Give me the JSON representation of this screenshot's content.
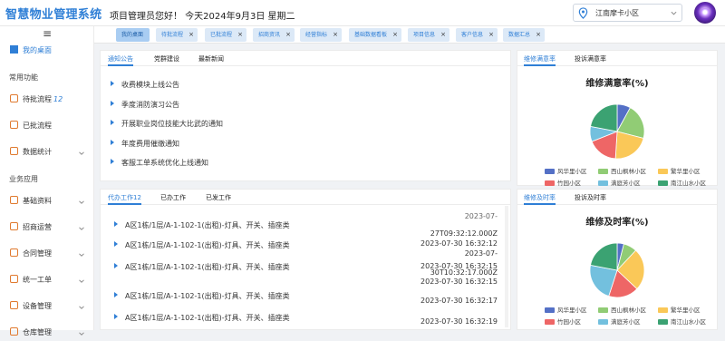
{
  "app": {
    "title": "智慧物业管理系统",
    "greeting": "项目管理员您好！ 今天2024年9月3日 星期二"
  },
  "location": {
    "value": "江南摩卡小区"
  },
  "sidebar": {
    "items": [
      {
        "label": "我的桌面",
        "active": true
      },
      {
        "section": "常用功能"
      },
      {
        "label": "待批流程",
        "badge": "12"
      },
      {
        "label": "已批流程"
      },
      {
        "label": "数据统计",
        "expandable": true
      },
      {
        "section": "业务应用"
      },
      {
        "label": "基础资料",
        "expandable": true
      },
      {
        "label": "招商运营",
        "expandable": true
      },
      {
        "label": "合同管理",
        "expandable": true
      },
      {
        "label": "统一工单",
        "expandable": true
      },
      {
        "label": "设备管理",
        "expandable": true
      },
      {
        "label": "仓库管理",
        "expandable": true
      }
    ]
  },
  "tabs": [
    {
      "label": "我的桌面",
      "active": true
    },
    {
      "label": "待批流程"
    },
    {
      "label": "已批流程"
    },
    {
      "label": "招商资讯"
    },
    {
      "label": "经营指标"
    },
    {
      "label": "基础数据看板"
    },
    {
      "label": "项目信息"
    },
    {
      "label": "客户信息"
    },
    {
      "label": "数据汇总"
    }
  ],
  "notices": {
    "tabs": [
      "通知公告",
      "党群建设",
      "最新新闻"
    ],
    "items": [
      "收费模块上线公告",
      "季度消防演习公告",
      "开展职业岗位技能大比武的通知",
      "年度费用催缴通知",
      "客服工单系统优化上线通知"
    ]
  },
  "work": {
    "tabs": [
      {
        "label": "代办工作",
        "badge": "12"
      },
      {
        "label": "已办工作"
      },
      {
        "label": "已发工作"
      }
    ],
    "top_fragment": "2023-07-",
    "rows": [
      {
        "title": "A区1栋/1层/A-1-102-1(出租)-灯具、开关、插座类",
        "time": [
          "27T09:32:12.000Z",
          "2023-07-30 16:32:12"
        ]
      },
      {
        "title": "A区1栋/1层/A-1-102-1(出租)-灯具、开关、插座类",
        "time": [
          "2023-07-30 16:32:15",
          "2023-07-"
        ]
      },
      {
        "title": "A区1栋/1层/A-1-102-1(出租)-灯具、开关、插座类",
        "time": [
          "30T10:32:17.000Z",
          "2023-07-30 16:32:15"
        ]
      },
      {
        "title": "A区1栋/1层/A-1-102-1(出租)-灯具、开关、插座类",
        "time": [
          "2023-07-30 16:32:17"
        ]
      },
      {
        "title": "A区1栋/1层/A-1-102-1(出租)-灯具、开关、插座类",
        "time": [
          "2023-07-30 16:32:19"
        ]
      }
    ]
  },
  "charts": [
    {
      "tabs": [
        "维修满意率",
        "投诉满意率"
      ],
      "chart_data": {
        "type": "pie",
        "title": "维修满意率(%)",
        "categories": [
          "风华里小区",
          "西山枫林小区",
          "繁华里小区",
          "竹园小区",
          "满庭芳小区",
          "南江山水小区"
        ],
        "values": [
          8,
          21,
          22,
          18,
          9,
          22
        ],
        "colors": [
          "#5470c6",
          "#91cc75",
          "#fac858",
          "#ee6666",
          "#73c0de",
          "#3ba272"
        ],
        "legend": "bottom"
      }
    },
    {
      "tabs": [
        "维修及时率",
        "投诉及时率"
      ],
      "chart_data": {
        "type": "pie",
        "title": "维修及时率(%)",
        "categories": [
          "风华里小区",
          "西山枫林小区",
          "繁华里小区",
          "竹园小区",
          "满庭芳小区",
          "南江山水小区"
        ],
        "values": [
          4,
          8,
          25,
          18,
          23,
          22
        ],
        "colors": [
          "#5470c6",
          "#91cc75",
          "#fac858",
          "#ee6666",
          "#73c0de",
          "#3ba272"
        ],
        "legend": "bottom"
      }
    }
  ]
}
